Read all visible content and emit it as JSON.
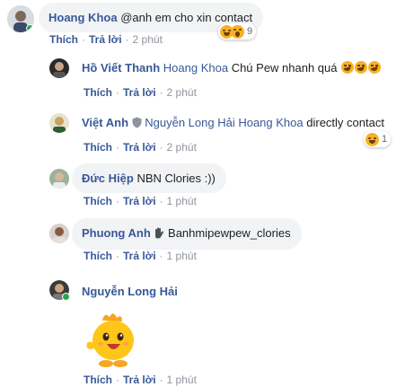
{
  "comments": [
    {
      "name": "Hoang Khoa",
      "text": "@anh em cho xin contact",
      "actions": {
        "like": "Thích",
        "reply": "Trả lời",
        "time": "2 phút"
      },
      "reaction_count": "9"
    },
    {
      "name": "Hồ Viết Thanh",
      "tag": "Hoang Khoa",
      "text": "Chú Pew nhanh quá",
      "actions": {
        "like": "Thích",
        "reply": "Trả lời",
        "time": "2 phút"
      }
    },
    {
      "name": "Việt Anh",
      "tag": "Nguyễn Long Hải Hoang Khoa",
      "text": "directly contact",
      "actions": {
        "like": "Thích",
        "reply": "Trả lời",
        "time": "2 phút"
      },
      "reaction_count": "1"
    },
    {
      "name": "Đức Hiệp",
      "text": "NBN Clories :))",
      "actions": {
        "like": "Thích",
        "reply": "Trả lời",
        "time": "1 phút"
      }
    },
    {
      "name": "Phuong Anh",
      "text": "Banhmipewpew_clories",
      "actions": {
        "like": "Thích",
        "reply": "Trả lời",
        "time": "1 phút"
      }
    },
    {
      "name": "Nguyễn Long Hải",
      "actions": {
        "like": "Thích",
        "reply": "Trả lời",
        "time": "1 phút"
      }
    }
  ],
  "colors": {
    "name": "#385898",
    "bubble": "#f2f3f5",
    "meta": "#90949c",
    "online": "#31a24c"
  },
  "icons": [
    "haha-emoji",
    "wow-emoji",
    "shield-badge-icon",
    "wave-hand-icon",
    "sticker-duck"
  ]
}
